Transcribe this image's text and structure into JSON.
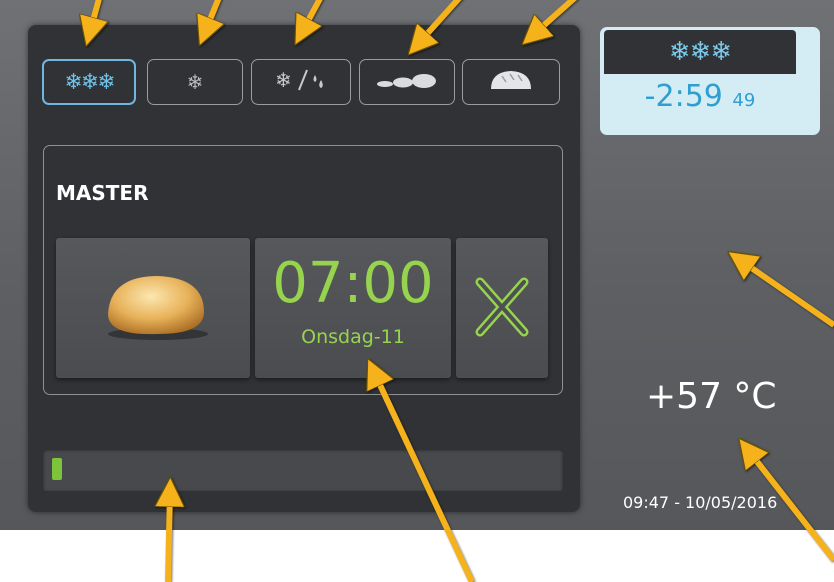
{
  "mode_bar": {
    "modes": [
      {
        "glyph": "❄❄❄",
        "icon": "deep-freeze-icon",
        "active": true
      },
      {
        "glyph": "❄",
        "icon": "freeze-icon",
        "active": false
      },
      {
        "glyph": "❄/💧",
        "icon": "freeze-thaw-icon",
        "active": false
      },
      {
        "icon": "proofing-small-loaves-icon",
        "active": false
      },
      {
        "icon": "proofing-loaf-icon",
        "active": false
      }
    ]
  },
  "program": {
    "name": "MASTER",
    "icon": "bread-roll-icon",
    "time": "07:00",
    "day": "Onsdag-11",
    "cancel_icon": "close-icon"
  },
  "progress": {
    "fraction": 0.02
  },
  "status": {
    "mode_glyph": "❄❄❄",
    "countdown_main": "-2:59",
    "countdown_seconds": "49"
  },
  "temperature": "+57 °C",
  "datetime": "09:47 - 10/05/2016",
  "colors": {
    "accent_green": "#96d44e",
    "accent_blue": "#6fc3ea",
    "panel": "#303235",
    "annotation_arrow": "#f5b21b"
  }
}
